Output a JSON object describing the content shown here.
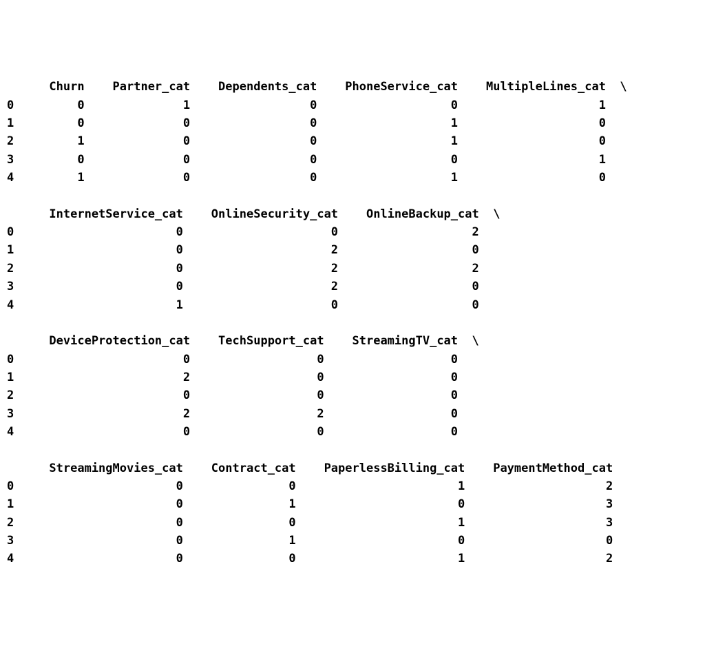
{
  "groups": [
    {
      "columns": [
        "Churn",
        "Partner_cat",
        "Dependents_cat",
        "PhoneService_cat",
        "MultipleLines_cat"
      ],
      "continued": true,
      "rows": [
        {
          "idx": "0",
          "vals": [
            "0",
            "1",
            "0",
            "0",
            "1"
          ]
        },
        {
          "idx": "1",
          "vals": [
            "0",
            "0",
            "0",
            "1",
            "0"
          ]
        },
        {
          "idx": "2",
          "vals": [
            "1",
            "0",
            "0",
            "1",
            "0"
          ]
        },
        {
          "idx": "3",
          "vals": [
            "0",
            "0",
            "0",
            "0",
            "1"
          ]
        },
        {
          "idx": "4",
          "vals": [
            "1",
            "0",
            "0",
            "1",
            "0"
          ]
        }
      ],
      "widths": [
        8,
        13,
        16,
        18,
        19
      ]
    },
    {
      "columns": [
        "InternetService_cat",
        "OnlineSecurity_cat",
        "OnlineBackup_cat"
      ],
      "continued": true,
      "rows": [
        {
          "idx": "0",
          "vals": [
            "0",
            "0",
            "2"
          ]
        },
        {
          "idx": "1",
          "vals": [
            "0",
            "2",
            "0"
          ]
        },
        {
          "idx": "2",
          "vals": [
            "0",
            "2",
            "2"
          ]
        },
        {
          "idx": "3",
          "vals": [
            "0",
            "2",
            "0"
          ]
        },
        {
          "idx": "4",
          "vals": [
            "1",
            "0",
            "0"
          ]
        }
      ],
      "widths": [
        22,
        20,
        18
      ]
    },
    {
      "columns": [
        "DeviceProtection_cat",
        "TechSupport_cat",
        "StreamingTV_cat"
      ],
      "continued": true,
      "rows": [
        {
          "idx": "0",
          "vals": [
            "0",
            "0",
            "0"
          ]
        },
        {
          "idx": "1",
          "vals": [
            "2",
            "0",
            "0"
          ]
        },
        {
          "idx": "2",
          "vals": [
            "0",
            "0",
            "0"
          ]
        },
        {
          "idx": "3",
          "vals": [
            "2",
            "2",
            "0"
          ]
        },
        {
          "idx": "4",
          "vals": [
            "0",
            "0",
            "0"
          ]
        }
      ],
      "widths": [
        23,
        17,
        17
      ]
    },
    {
      "columns": [
        "StreamingMovies_cat",
        "Contract_cat",
        "PaperlessBilling_cat",
        "PaymentMethod_cat"
      ],
      "continued": false,
      "rows": [
        {
          "idx": "0",
          "vals": [
            "0",
            "0",
            "1",
            "2"
          ]
        },
        {
          "idx": "1",
          "vals": [
            "0",
            "1",
            "0",
            "3"
          ]
        },
        {
          "idx": "2",
          "vals": [
            "0",
            "0",
            "1",
            "3"
          ]
        },
        {
          "idx": "3",
          "vals": [
            "0",
            "1",
            "0",
            "0"
          ]
        },
        {
          "idx": "4",
          "vals": [
            "0",
            "0",
            "1",
            "2"
          ]
        }
      ],
      "widths": [
        22,
        14,
        22,
        19
      ]
    }
  ],
  "indexWidth": 1
}
